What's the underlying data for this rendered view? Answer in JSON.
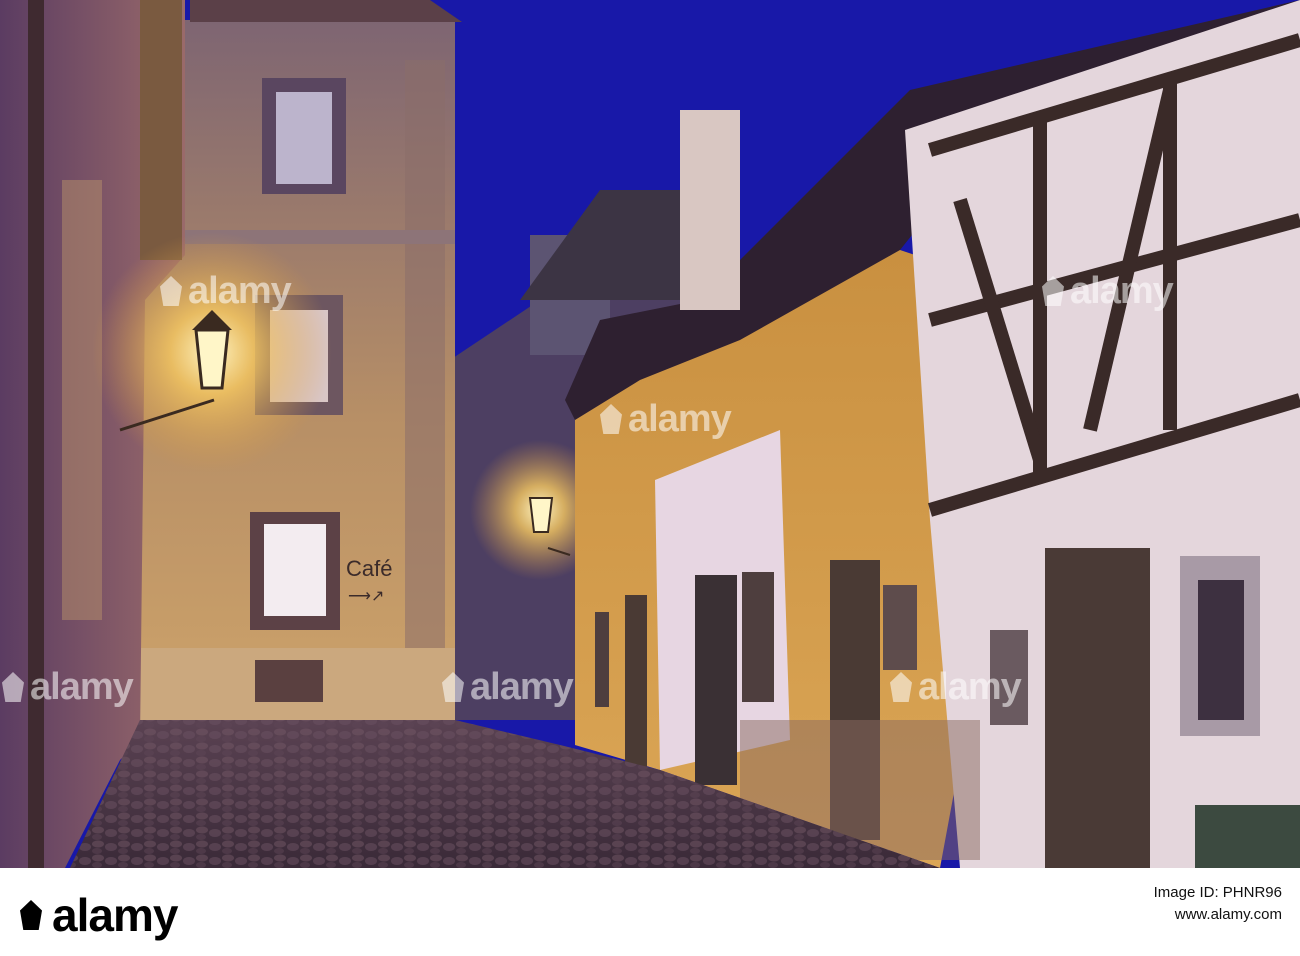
{
  "photo": {
    "sign_text": "Café",
    "sign_arrow": "⟶↗",
    "watermark_text": "alamy"
  },
  "footer": {
    "logo_text": "alamy",
    "image_id_text": "Image ID: PHNR96",
    "url_text": "www.alamy.com"
  },
  "colors": {
    "sky": "#1818a8",
    "wall_lit": "#d8a24a",
    "wall_shadow": "#6a4a70",
    "cobble": "#4a3646",
    "lamp": "#fff2b8"
  }
}
